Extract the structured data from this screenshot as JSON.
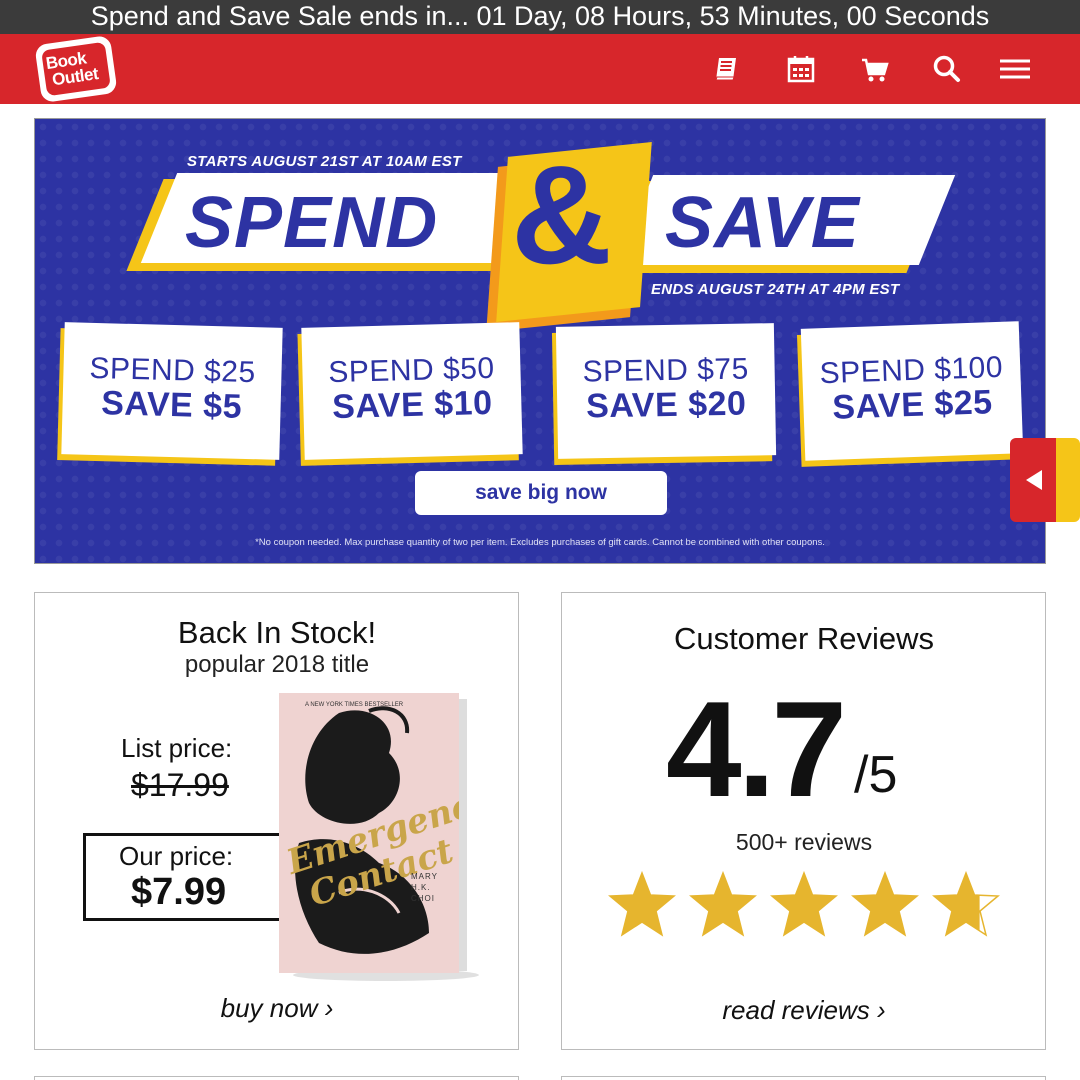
{
  "countdown_bar": {
    "text": "Spend and Save Sale ends in... 01 Day, 08 Hours, 53 Minutes, 00 Seconds"
  },
  "navbar": {
    "logo_line1": "Book",
    "logo_line2": "Outlet",
    "icons": [
      "book-icon",
      "calendar-icon",
      "cart-icon",
      "search-icon",
      "menu-icon"
    ],
    "accent_color": "#d7262b"
  },
  "banner": {
    "starts": "STARTS AUGUST 21ST AT 10AM EST",
    "spend_word": "SPEND",
    "amp": "&",
    "save_word": "SAVE",
    "ends": "ENDS AUGUST 24TH AT 4PM EST",
    "tiers": [
      {
        "spend": "SPEND $25",
        "save": "SAVE $5"
      },
      {
        "spend": "SPEND $50",
        "save": "SAVE $10"
      },
      {
        "spend": "SPEND $75",
        "save": "SAVE $20"
      },
      {
        "spend": "SPEND $100",
        "save": "SAVE $25"
      }
    ],
    "cta": "save big now",
    "fine_print": "*No coupon needed. Max purchase quantity of two per item. Excludes purchases of gift cards. Cannot be combined with other coupons.",
    "colors": {
      "background": "#2d33a3",
      "accent": "#f5c518"
    }
  },
  "back_in_stock": {
    "title": "Back In Stock!",
    "subtitle": "popular 2018 title",
    "list_label": "List price:",
    "list_price": "$17.99",
    "our_label": "Our price:",
    "our_price": "$7.99",
    "book_title_line1": "Emergency",
    "book_title_line2": "Contact",
    "book_author": "MARY H.K. CHOI",
    "book_badge": "A NEW YORK TIMES BESTSELLER",
    "cta": "buy now ›"
  },
  "reviews": {
    "title": "Customer Reviews",
    "score": "4.7",
    "max": "/5",
    "count": "500+ reviews",
    "rating_value": 4.7,
    "star_color": "#e6b52e",
    "cta": "read reviews ›"
  }
}
